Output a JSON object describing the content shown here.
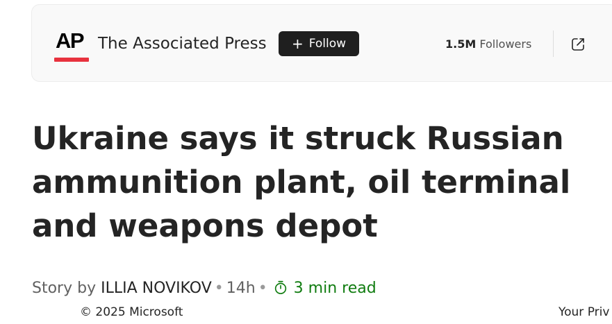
{
  "publisher": {
    "logo_text": "AP",
    "name": "The Associated Press",
    "follow_plus": "+",
    "follow_label": "Follow",
    "followers_count": "1.5M",
    "followers_label": "Followers",
    "share_icon": "share-external-icon",
    "logo_accent_color": "#e8323e"
  },
  "article": {
    "headline": "Ukraine says it struck Russian ammunition plant, oil terminal and weapons depot",
    "story_by_label": "Story by",
    "author": "ILLIA NOVIKOV",
    "separator": "•",
    "age": "14h",
    "read_time": "3 min read",
    "read_time_color": "#107c10"
  },
  "footer": {
    "copyright": "© 2025 Microsoft",
    "privacy_link": "Your Priv"
  }
}
